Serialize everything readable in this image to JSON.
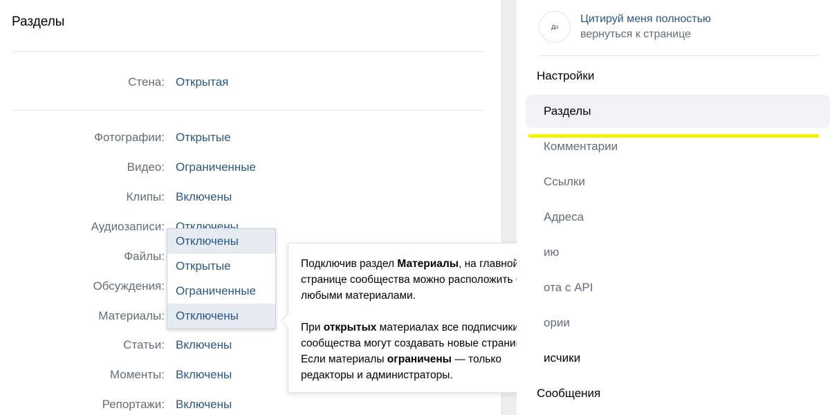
{
  "main": {
    "title": "Разделы",
    "wall": {
      "label": "Стена:",
      "value": "Открытая"
    },
    "sections": [
      {
        "label": "Фотографии:",
        "value": "Открытые"
      },
      {
        "label": "Видео:",
        "value": "Ограниченные"
      },
      {
        "label": "Клипы:",
        "value": "Включены"
      },
      {
        "label": "Аудиозаписи:",
        "value": "Отключены"
      },
      {
        "label": "Файлы:",
        "value": ""
      },
      {
        "label": "Обсуждения:",
        "value": ""
      },
      {
        "label": "Материалы:",
        "value": ""
      },
      {
        "label": "Статьи:",
        "value": "Включены"
      },
      {
        "label": "Моменты:",
        "value": "Включены"
      },
      {
        "label": "Репортажи:",
        "value": "Включены"
      }
    ]
  },
  "dropdown": {
    "options": [
      "Отключены",
      "Открытые",
      "Ограниченные",
      "Отключены"
    ]
  },
  "tooltip": {
    "p1_start": "Подключив раздел ",
    "p1_bold": "Материалы",
    "p1_end": ", на главной странице сообщества можно расположить блок с любыми материалами.",
    "p2_start": "При ",
    "p2_bold1": "открытых",
    "p2_mid": " материалах все подписчики сообщества могут создавать новые страницы. Если материалы ",
    "p2_bold2": "ограничены",
    "p2_end": " — только редакторы и администраторы."
  },
  "sidebar": {
    "group_name": "Цитируй меня полностью",
    "back_link": "вернуться к странице",
    "avatar_text": "Дл",
    "heading": "Настройки",
    "items": [
      "Разделы",
      "Комментарии",
      "Ссылки",
      "Адреса",
      "ию",
      "ота с API",
      "ории",
      "исчики",
      "Сообщения"
    ]
  },
  "colors": {
    "link": "#2a5885",
    "label": "#626d7a",
    "highlight": "#f5f500"
  }
}
